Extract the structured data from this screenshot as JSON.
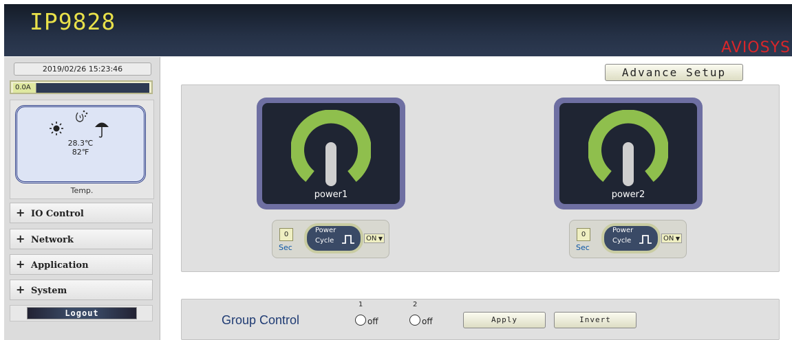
{
  "header": {
    "model": "IP9828",
    "vendor": "AVIOSYS"
  },
  "sidebar": {
    "datetime": "2019/02/26 15:23:46",
    "current": {
      "label": "0.0A",
      "level": 0.0
    },
    "temperature": {
      "celsius": "28.3℃",
      "fahrenheit": "82℉",
      "label": "Temp."
    },
    "menu": [
      {
        "label": "IO Control"
      },
      {
        "label": "Network"
      },
      {
        "label": "Application"
      },
      {
        "label": "System"
      }
    ],
    "logout_label": "Logout"
  },
  "advance_setup_label": "Advance Setup",
  "outlets": [
    {
      "name": "power1",
      "seconds": "0",
      "sec_label": "Sec",
      "cycle_line1": "Power",
      "cycle_line2": "Cycle",
      "mode": "ON"
    },
    {
      "name": "power2",
      "seconds": "0",
      "sec_label": "Sec",
      "cycle_line1": "Power",
      "cycle_line2": "Cycle",
      "mode": "ON"
    }
  ],
  "group_control": {
    "title": "Group Control",
    "items": [
      {
        "number": "1",
        "state": "off"
      },
      {
        "number": "2",
        "state": "off"
      }
    ],
    "apply_label": "Apply",
    "invert_label": "Invert"
  },
  "colors": {
    "power_arc": "#8fbf4d",
    "plug_frame": "#6e6fa2",
    "brand": "#e8e04a",
    "vendor": "#d9262a"
  }
}
